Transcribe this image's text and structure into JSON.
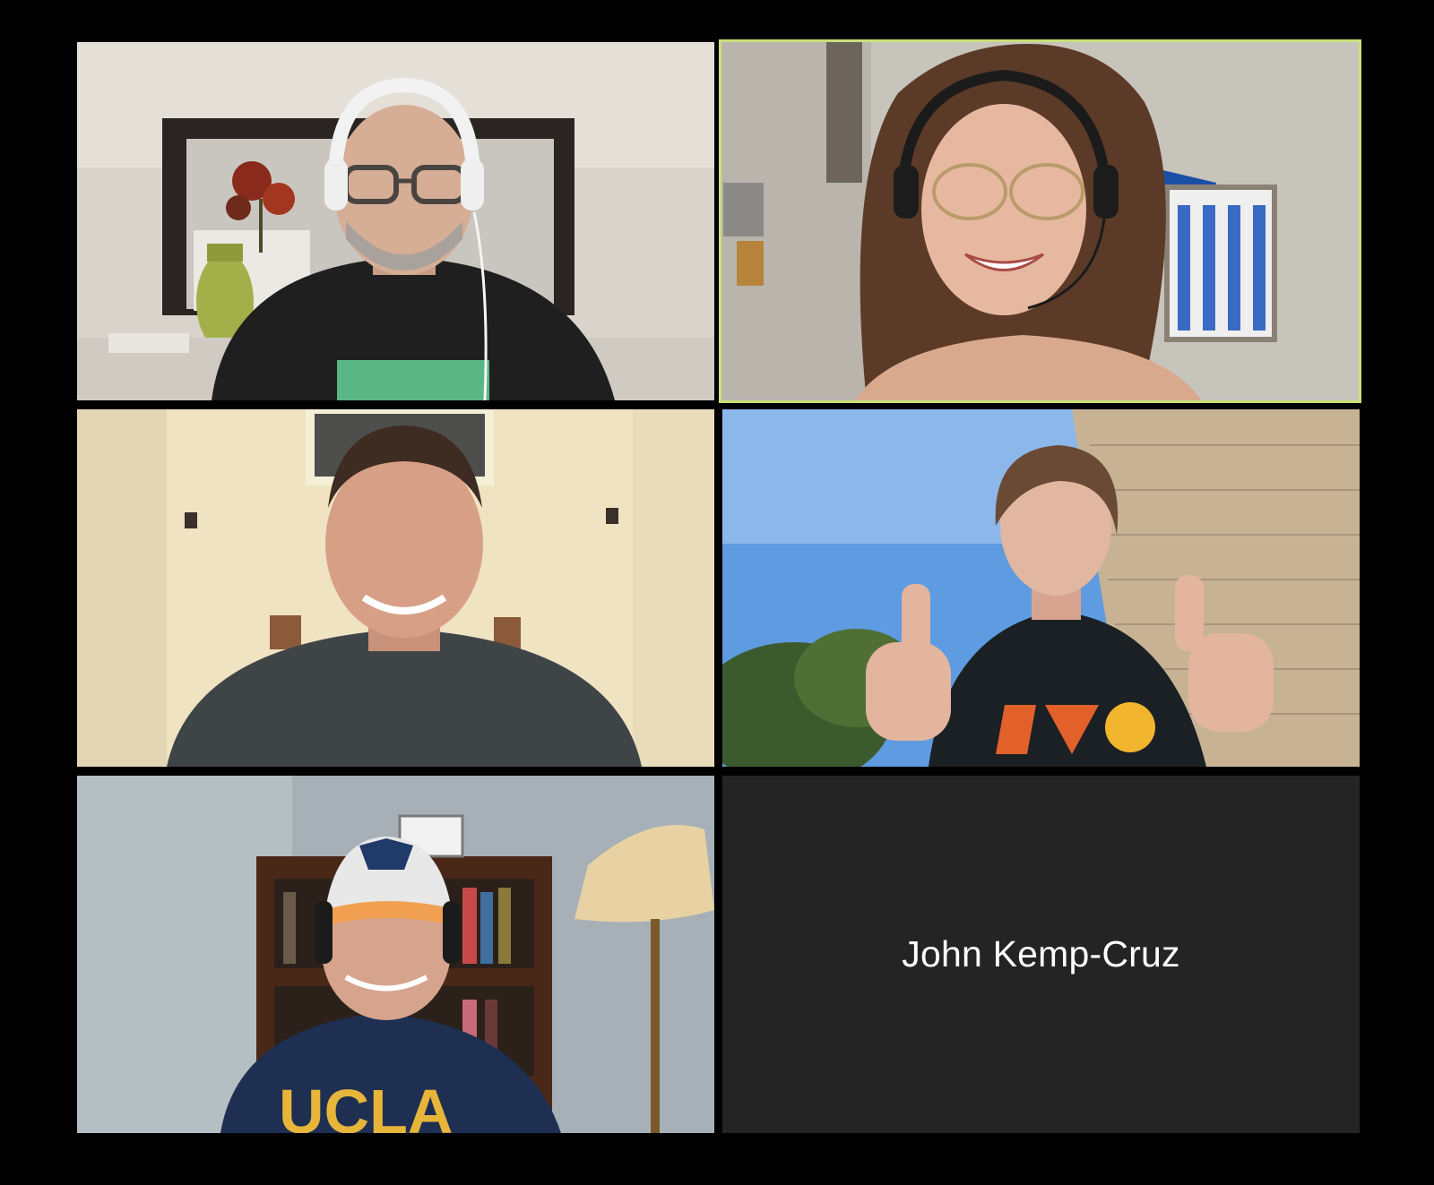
{
  "meeting": {
    "layout": "gallery-view",
    "active_speaker_color": "#c9e07a",
    "participants": [
      {
        "video": "on",
        "speaking": false
      },
      {
        "video": "on",
        "speaking": true
      },
      {
        "video": "on",
        "speaking": false
      },
      {
        "video": "on",
        "speaking": false
      },
      {
        "video": "on",
        "speaking": false
      },
      {
        "video": "off",
        "speaking": false,
        "name": "John Kemp-Cruz"
      }
    ]
  }
}
